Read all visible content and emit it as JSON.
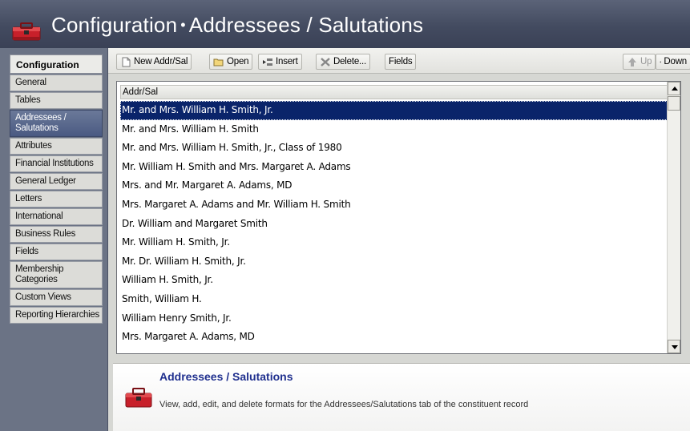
{
  "window": {
    "title_part1": "Configuration",
    "title_separator": "•",
    "title_part2": "Addressees / Salutations"
  },
  "nav": {
    "header": "Configuration",
    "items": [
      {
        "label": "General",
        "active": false
      },
      {
        "label": "Tables",
        "active": false
      },
      {
        "label": "Addressees / Salutations",
        "active": true
      },
      {
        "label": "Attributes",
        "active": false
      },
      {
        "label": "Financial Institutions",
        "active": false
      },
      {
        "label": "General Ledger",
        "active": false
      },
      {
        "label": "Letters",
        "active": false
      },
      {
        "label": "International",
        "active": false
      },
      {
        "label": "Business Rules",
        "active": false
      },
      {
        "label": "Fields",
        "active": false
      },
      {
        "label": "Membership Categories",
        "active": false
      },
      {
        "label": "Custom Views",
        "active": false
      },
      {
        "label": "Reporting Hierarchies",
        "active": false
      }
    ]
  },
  "toolbar": {
    "new_label": "New Addr/Sal",
    "open_label": "Open",
    "insert_label": "Insert",
    "delete_label": "Delete...",
    "fields_label": "Fields",
    "up_label": "Up",
    "down_label": "Down"
  },
  "grid": {
    "column_header": "Addr/Sal",
    "selected_index": 0,
    "rows": [
      "Mr. and Mrs. William H. Smith, Jr.",
      "Mr. and Mrs. William H. Smith",
      "Mr. and Mrs. William H. Smith, Jr., Class of 1980",
      "Mr. William H. Smith and Mrs. Margaret A. Adams",
      "Mrs. and Mr. Margaret A. Adams, MD",
      "Mrs. Margaret A. Adams and Mr. William H. Smith",
      "Dr. William and Margaret Smith",
      "Mr. William H. Smith, Jr.",
      "Mr. Dr. William H. Smith, Jr.",
      "William H. Smith, Jr.",
      "Smith, William H.",
      "William Henry Smith, Jr.",
      "Mrs. Margaret A. Adams, MD"
    ]
  },
  "info": {
    "title": "Addressees / Salutations",
    "description": "View, add, edit, and delete formats for the Addressees/Salutations tab of the constituent record"
  },
  "colors": {
    "title_bar": "#434b60",
    "selection": "#0a246a",
    "info_title": "#1f2f8e",
    "icon_red": "#c8202a"
  },
  "icons": {
    "app": "toolbox-icon",
    "new": "new-document-icon",
    "open": "open-folder-icon",
    "insert": "insert-row-icon",
    "delete": "delete-x-icon",
    "up": "arrow-up-icon",
    "down": "arrow-down-icon"
  }
}
